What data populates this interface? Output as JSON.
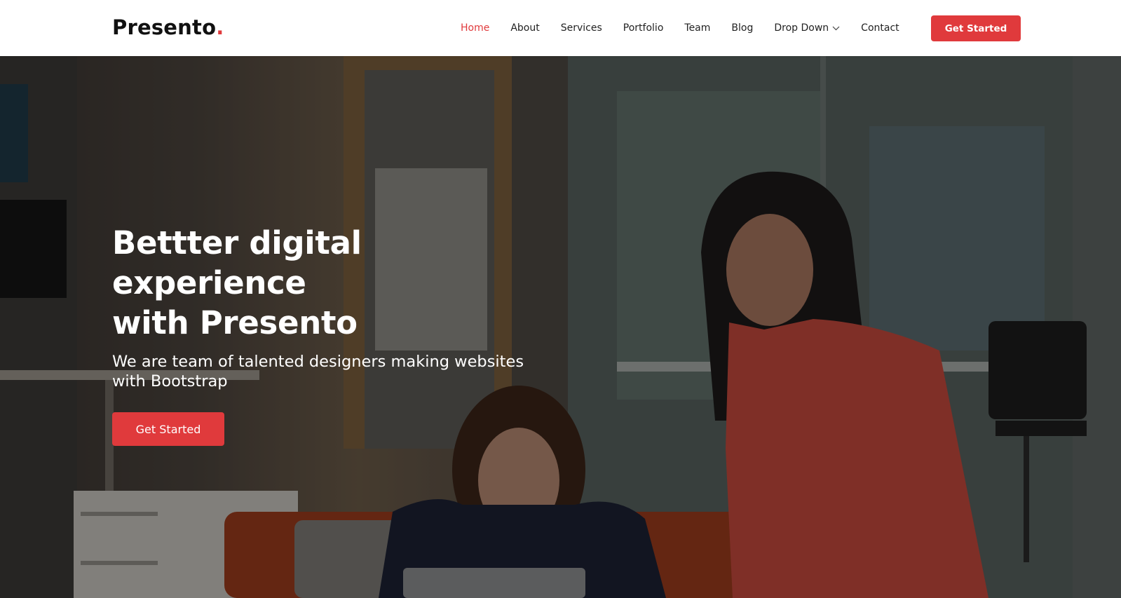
{
  "brand": {
    "name": "Presento",
    "dot": ".",
    "accent": "#e03a3c"
  },
  "nav": {
    "items": [
      {
        "label": "Home",
        "active": true
      },
      {
        "label": "About"
      },
      {
        "label": "Services"
      },
      {
        "label": "Portfolio"
      },
      {
        "label": "Team"
      },
      {
        "label": "Blog"
      },
      {
        "label": "Drop Down",
        "icon": "chevron-down-icon"
      },
      {
        "label": "Contact"
      }
    ],
    "cta_label": "Get Started"
  },
  "hero": {
    "title_line1": "Bettter digital experience",
    "title_line2": "with Presento",
    "subtitle": "We are team of talented designers making websites with Bootstrap",
    "cta_label": "Get Started",
    "background": "photo of two women in an office looking at a laptop"
  }
}
